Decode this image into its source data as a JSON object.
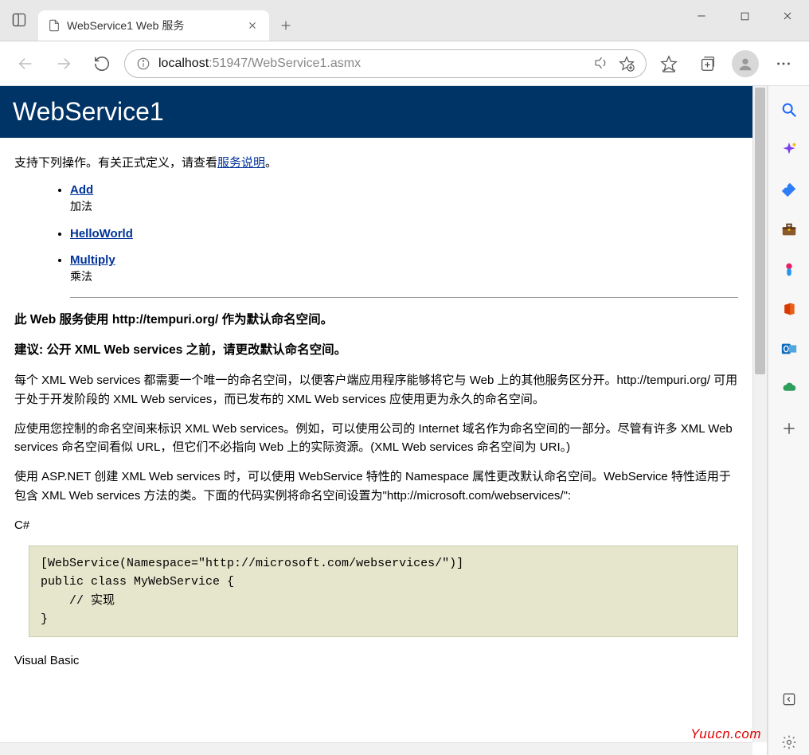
{
  "browser": {
    "tab_title": "WebService1 Web 服务",
    "url_host": "localhost",
    "url_rest": ":51947/WebService1.asmx"
  },
  "page": {
    "title": "WebService1",
    "intro_prefix": "支持下列操作。有关正式定义，请查看",
    "intro_link": "服务说明",
    "intro_suffix": "。",
    "ops": [
      {
        "name": "Add",
        "desc": "加法"
      },
      {
        "name": "HelloWorld",
        "desc": ""
      },
      {
        "name": "Multiply",
        "desc": "乘法"
      }
    ],
    "ns_line": "此 Web 服务使用 http://tempuri.org/ 作为默认命名空间。",
    "advice_line": "建议: 公开 XML Web services 之前，请更改默认命名空间。",
    "para1": "每个 XML Web services 都需要一个唯一的命名空间，以便客户端应用程序能够将它与 Web 上的其他服务区分开。http://tempuri.org/ 可用于处于开发阶段的 XML Web services，而已发布的 XML Web services 应使用更为永久的命名空间。",
    "para2": "应使用您控制的命名空间来标识 XML Web services。例如，可以使用公司的 Internet 域名作为命名空间的一部分。尽管有许多 XML Web services 命名空间看似 URL，但它们不必指向 Web 上的实际资源。(XML Web services 命名空间为 URI。)",
    "para3": "使用 ASP.NET 创建 XML Web services 时，可以使用 WebService 特性的 Namespace 属性更改默认命名空间。WebService 特性适用于包含 XML Web services 方法的类。下面的代码实例将命名空间设置为\"http://microsoft.com/webservices/\":",
    "csharp_label": "C#",
    "csharp_code": "[WebService(Namespace=\"http://microsoft.com/webservices/\")]\npublic class MyWebService {\n    // 实现\n}",
    "vb_label": "Visual Basic"
  },
  "watermark": "Yuucn.com"
}
